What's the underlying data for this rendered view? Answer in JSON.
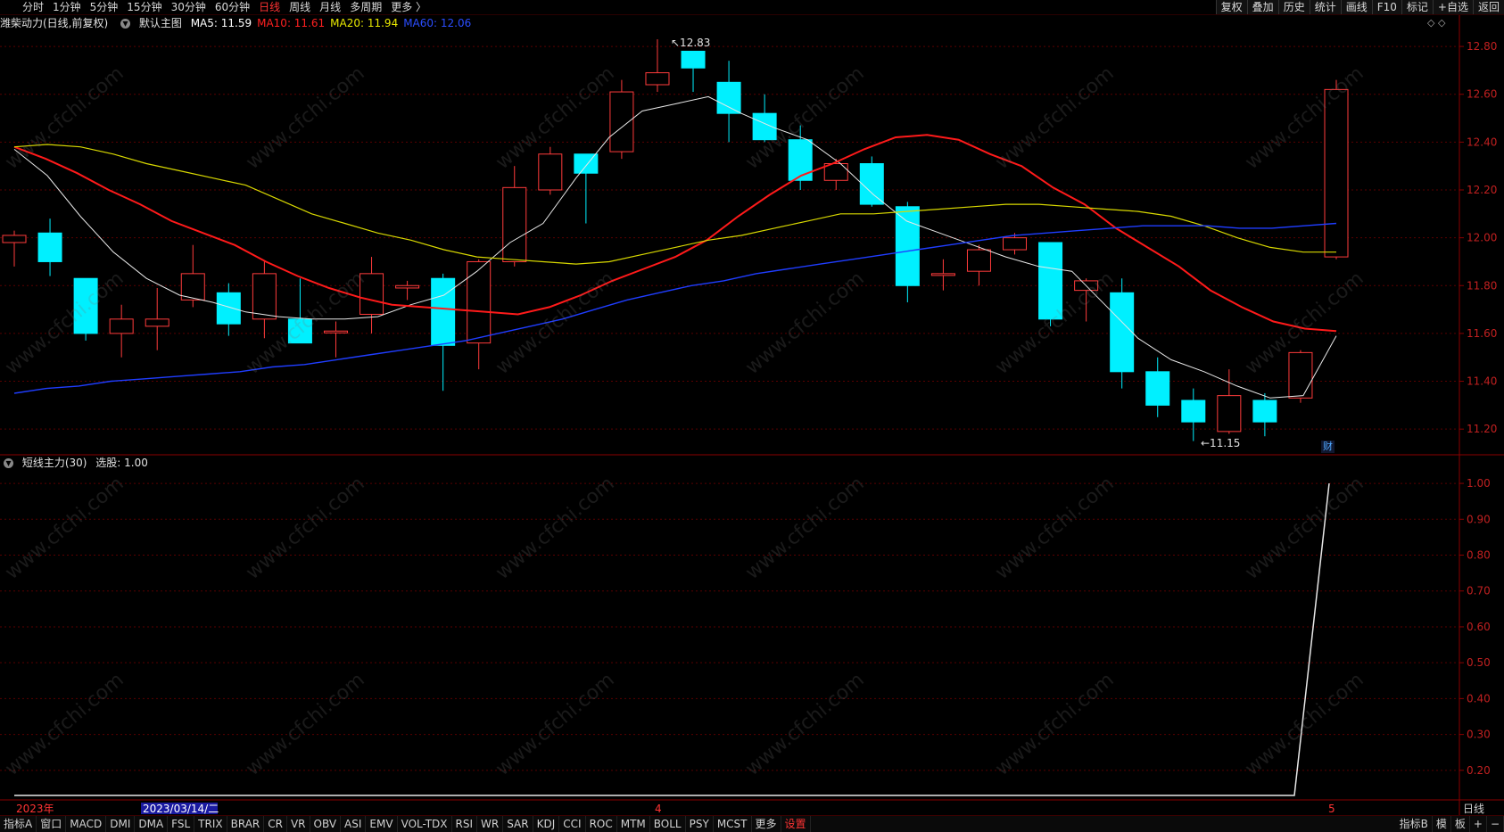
{
  "topbar": {
    "periods": [
      {
        "label": "分时"
      },
      {
        "label": "1分钟"
      },
      {
        "label": "5分钟"
      },
      {
        "label": "15分钟"
      },
      {
        "label": "30分钟"
      },
      {
        "label": "60分钟"
      },
      {
        "label": "日线",
        "active": true
      },
      {
        "label": "周线"
      },
      {
        "label": "月线"
      },
      {
        "label": "多周期"
      },
      {
        "label": "更多 〉"
      }
    ],
    "tools": [
      {
        "label": "复权"
      },
      {
        "label": "叠加"
      },
      {
        "label": "历史"
      },
      {
        "label": "统计"
      },
      {
        "label": "画线"
      },
      {
        "label": "F10"
      },
      {
        "label": "标记"
      },
      {
        "label": "+自选"
      },
      {
        "label": "返回"
      }
    ]
  },
  "main_header": {
    "title": "潍柴动力(日线,前复权)",
    "template": "默认主图",
    "ma": [
      {
        "label": "MA5: 11.59",
        "color": "#ffffff"
      },
      {
        "label": "MA10: 11.61",
        "color": "#ff2020"
      },
      {
        "label": "MA20: 11.94",
        "color": "#e8e800"
      },
      {
        "label": "MA60: 12.06",
        "color": "#2a4dff"
      }
    ],
    "diamonds": "◇ ◇"
  },
  "sub_header": {
    "title": "短线主力(30)",
    "value": "选股: 1.00"
  },
  "main_chart": {
    "y_ticks": [
      "12.80",
      "12.60",
      "12.40",
      "12.20",
      "12.00",
      "11.80",
      "11.60",
      "11.40",
      "11.20"
    ],
    "high_label": "12.83",
    "low_label": "11.15",
    "fin_tag": "财"
  },
  "sub_chart": {
    "y_ticks": [
      "1.00",
      "0.90",
      "0.80",
      "0.70",
      "0.60",
      "0.50",
      "0.40",
      "0.30",
      "0.20"
    ]
  },
  "x_axis": {
    "labels": [
      {
        "text": "2023年",
        "color": "#ff3333"
      },
      {
        "text": "2023/03/14/二",
        "color": "#ffffff",
        "highlight": true
      },
      {
        "text": "4",
        "color": "#ff3333"
      },
      {
        "text": "5",
        "color": "#ff3333"
      }
    ],
    "right_label": "日线"
  },
  "bottombar": {
    "indicators": [
      "指标A",
      "窗口",
      "MACD",
      "DMI",
      "DMA",
      "FSL",
      "TRIX",
      "BRAR",
      "CR",
      "VR",
      "OBV",
      "ASI",
      "EMV",
      "VOL-TDX",
      "RSI",
      "WR",
      "SAR",
      "KDJ",
      "CCI",
      "ROC",
      "MTM",
      "BOLL",
      "PSY",
      "MCST",
      "更多",
      "设置"
    ],
    "right": [
      "指标B",
      "模",
      "板",
      "+",
      "−"
    ]
  },
  "watermark": "www.cfchi.com",
  "colors": {
    "up": "#ff3b3b",
    "down": "#00f0ff",
    "ma5": "#e8e8e8",
    "ma10": "#ff1a1a",
    "ma20": "#d8d800",
    "ma60": "#1f3dff",
    "grid": "#5a0000",
    "axis": "#8a0000"
  },
  "chart_data": [
    {
      "type": "candlestick",
      "title": "潍柴动力(日线,前复权)",
      "ylim": [
        11.1,
        12.86
      ],
      "candles": [
        {
          "o": 11.98,
          "c": 12.01,
          "h": 12.03,
          "l": 11.88
        },
        {
          "o": 12.02,
          "c": 11.9,
          "h": 12.08,
          "l": 11.84
        },
        {
          "o": 11.83,
          "c": 11.6,
          "h": 11.83,
          "l": 11.57
        },
        {
          "o": 11.6,
          "c": 11.66,
          "h": 11.72,
          "l": 11.5
        },
        {
          "o": 11.63,
          "c": 11.66,
          "h": 11.79,
          "l": 11.53
        },
        {
          "o": 11.74,
          "c": 11.85,
          "h": 11.97,
          "l": 11.71
        },
        {
          "o": 11.77,
          "c": 11.64,
          "h": 11.81,
          "l": 11.59
        },
        {
          "o": 11.66,
          "c": 11.85,
          "h": 11.9,
          "l": 11.58
        },
        {
          "o": 11.66,
          "c": 11.56,
          "h": 11.83,
          "l": 11.56
        },
        {
          "o": 11.61,
          "c": 11.61,
          "h": 11.65,
          "l": 11.5
        },
        {
          "o": 11.68,
          "c": 11.85,
          "h": 11.92,
          "l": 11.6
        },
        {
          "o": 11.79,
          "c": 11.8,
          "h": 11.82,
          "l": 11.74
        },
        {
          "o": 11.83,
          "c": 11.55,
          "h": 11.85,
          "l": 11.36
        },
        {
          "o": 11.56,
          "c": 11.9,
          "h": 11.91,
          "l": 11.45
        },
        {
          "o": 11.9,
          "c": 12.21,
          "h": 12.3,
          "l": 11.88
        },
        {
          "o": 12.2,
          "c": 12.35,
          "h": 12.38,
          "l": 12.18
        },
        {
          "o": 12.35,
          "c": 12.27,
          "h": 12.35,
          "l": 12.06
        },
        {
          "o": 12.36,
          "c": 12.61,
          "h": 12.66,
          "l": 12.33
        },
        {
          "o": 12.64,
          "c": 12.69,
          "h": 12.83,
          "l": 12.61
        },
        {
          "o": 12.78,
          "c": 12.71,
          "h": 12.78,
          "l": 12.61
        },
        {
          "o": 12.65,
          "c": 12.52,
          "h": 12.74,
          "l": 12.4
        },
        {
          "o": 12.52,
          "c": 12.41,
          "h": 12.6,
          "l": 12.4
        },
        {
          "o": 12.41,
          "c": 12.24,
          "h": 12.47,
          "l": 12.2
        },
        {
          "o": 12.24,
          "c": 12.31,
          "h": 12.33,
          "l": 12.2
        },
        {
          "o": 12.31,
          "c": 12.14,
          "h": 12.34,
          "l": 12.13
        },
        {
          "o": 12.13,
          "c": 11.8,
          "h": 12.15,
          "l": 11.73
        },
        {
          "o": 11.85,
          "c": 11.85,
          "h": 11.91,
          "l": 11.78
        },
        {
          "o": 11.86,
          "c": 11.95,
          "h": 11.97,
          "l": 11.8
        },
        {
          "o": 11.95,
          "c": 12.0,
          "h": 12.02,
          "l": 11.93
        },
        {
          "o": 11.98,
          "c": 11.66,
          "h": 11.98,
          "l": 11.63
        },
        {
          "o": 11.78,
          "c": 11.82,
          "h": 11.83,
          "l": 11.65
        },
        {
          "o": 11.77,
          "c": 11.44,
          "h": 11.83,
          "l": 11.37
        },
        {
          "o": 11.44,
          "c": 11.3,
          "h": 11.5,
          "l": 11.25
        },
        {
          "o": 11.32,
          "c": 11.23,
          "h": 11.37,
          "l": 11.15
        },
        {
          "o": 11.19,
          "c": 11.34,
          "h": 11.45,
          "l": 11.18
        },
        {
          "o": 11.32,
          "c": 11.23,
          "h": 11.35,
          "l": 11.17
        },
        {
          "o": 11.33,
          "c": 11.52,
          "h": 11.53,
          "l": 11.31
        },
        {
          "o": 11.92,
          "c": 12.62,
          "h": 12.66,
          "l": 11.91
        }
      ],
      "series": [
        {
          "name": "MA5",
          "values": [
            12.37,
            12.26,
            12.09,
            11.94,
            11.83,
            11.76,
            11.73,
            11.69,
            11.67,
            11.66,
            11.66,
            11.67,
            11.72,
            11.76,
            11.86,
            11.98,
            12.06,
            12.25,
            12.42,
            12.53,
            12.56,
            12.59,
            12.52,
            12.46,
            12.41,
            12.31,
            12.18,
            12.07,
            12.02,
            11.97,
            11.92,
            11.88,
            11.86,
            11.72,
            11.58,
            11.49,
            11.44,
            11.38,
            11.33,
            11.34,
            11.59
          ]
        },
        {
          "name": "MA10",
          "values": [
            12.38,
            12.33,
            12.27,
            12.2,
            12.14,
            12.07,
            12.02,
            11.97,
            11.9,
            11.84,
            11.79,
            11.75,
            11.72,
            11.71,
            11.7,
            11.69,
            11.68,
            11.71,
            11.76,
            11.82,
            11.87,
            11.92,
            11.99,
            12.09,
            12.18,
            12.26,
            12.31,
            12.37,
            12.42,
            12.43,
            12.41,
            12.35,
            12.3,
            12.21,
            12.14,
            12.04,
            11.96,
            11.88,
            11.78,
            11.71,
            11.65,
            11.62,
            11.61
          ]
        },
        {
          "name": "MA20",
          "values": [
            12.38,
            12.39,
            12.38,
            12.35,
            12.31,
            12.28,
            12.25,
            12.22,
            12.16,
            12.1,
            12.06,
            12.02,
            11.99,
            11.95,
            11.92,
            11.91,
            11.9,
            11.89,
            11.9,
            11.93,
            11.96,
            11.99,
            12.01,
            12.04,
            12.07,
            12.1,
            12.1,
            12.11,
            12.12,
            12.13,
            12.14,
            12.14,
            12.13,
            12.12,
            12.11,
            12.09,
            12.05,
            12.0,
            11.96,
            11.94,
            11.94
          ]
        },
        {
          "name": "MA60",
          "values": [
            11.35,
            11.37,
            11.38,
            11.4,
            11.41,
            11.42,
            11.43,
            11.44,
            11.46,
            11.47,
            11.49,
            11.51,
            11.53,
            11.55,
            11.57,
            11.6,
            11.63,
            11.66,
            11.7,
            11.74,
            11.77,
            11.8,
            11.82,
            11.85,
            11.87,
            11.89,
            11.91,
            11.93,
            11.95,
            11.97,
            11.99,
            12.01,
            12.02,
            12.03,
            12.04,
            12.05,
            12.05,
            12.05,
            12.04,
            12.04,
            12.05,
            12.06
          ]
        }
      ]
    },
    {
      "type": "line",
      "title": "短线主力(30)",
      "ylim": [
        0.12,
        1.03
      ],
      "series": [
        {
          "name": "选股",
          "values": [
            0,
            0,
            0,
            0,
            0,
            0,
            0,
            0,
            0,
            0,
            0,
            0,
            0,
            0,
            0,
            0,
            0,
            0,
            0,
            0,
            0,
            0,
            0,
            0,
            0,
            0,
            0,
            0,
            0,
            0,
            0,
            0,
            0,
            0,
            0,
            0,
            0,
            0,
            0,
            0,
            0,
            0,
            0,
            0,
            0,
            0,
            0,
            0,
            0,
            0,
            0,
            0,
            0,
            0,
            0,
            0,
            0,
            0,
            0,
            0,
            0,
            0,
            0,
            0,
            0,
            0,
            0,
            0,
            0,
            0,
            0,
            0,
            0,
            0,
            0,
            0,
            0,
            0,
            0,
            0,
            0,
            0,
            0,
            0,
            0,
            0,
            0,
            0,
            0,
            0,
            0,
            0,
            0,
            0,
            0,
            0,
            0,
            0,
            0,
            1.0
          ]
        }
      ]
    }
  ]
}
